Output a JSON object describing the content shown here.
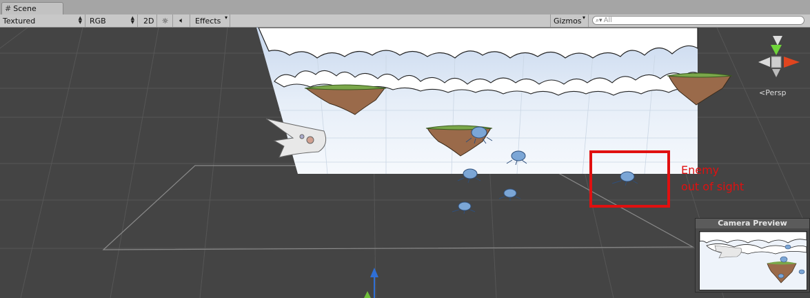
{
  "tab": {
    "label": "Scene"
  },
  "toolbar": {
    "render_mode": "Textured",
    "color_mode": "RGB",
    "mode_2d": "2D",
    "effects_label": "Effects",
    "gizmos_label": "Gizmos",
    "search_placeholder": "All"
  },
  "viewport": {
    "persp_label": "Persp",
    "annotation_line1": "Enemy",
    "annotation_line2": "out of sight"
  },
  "camera_preview": {
    "title": "Camera Preview"
  },
  "colors": {
    "annotation": "#e01010",
    "grid_background": "#444444"
  }
}
